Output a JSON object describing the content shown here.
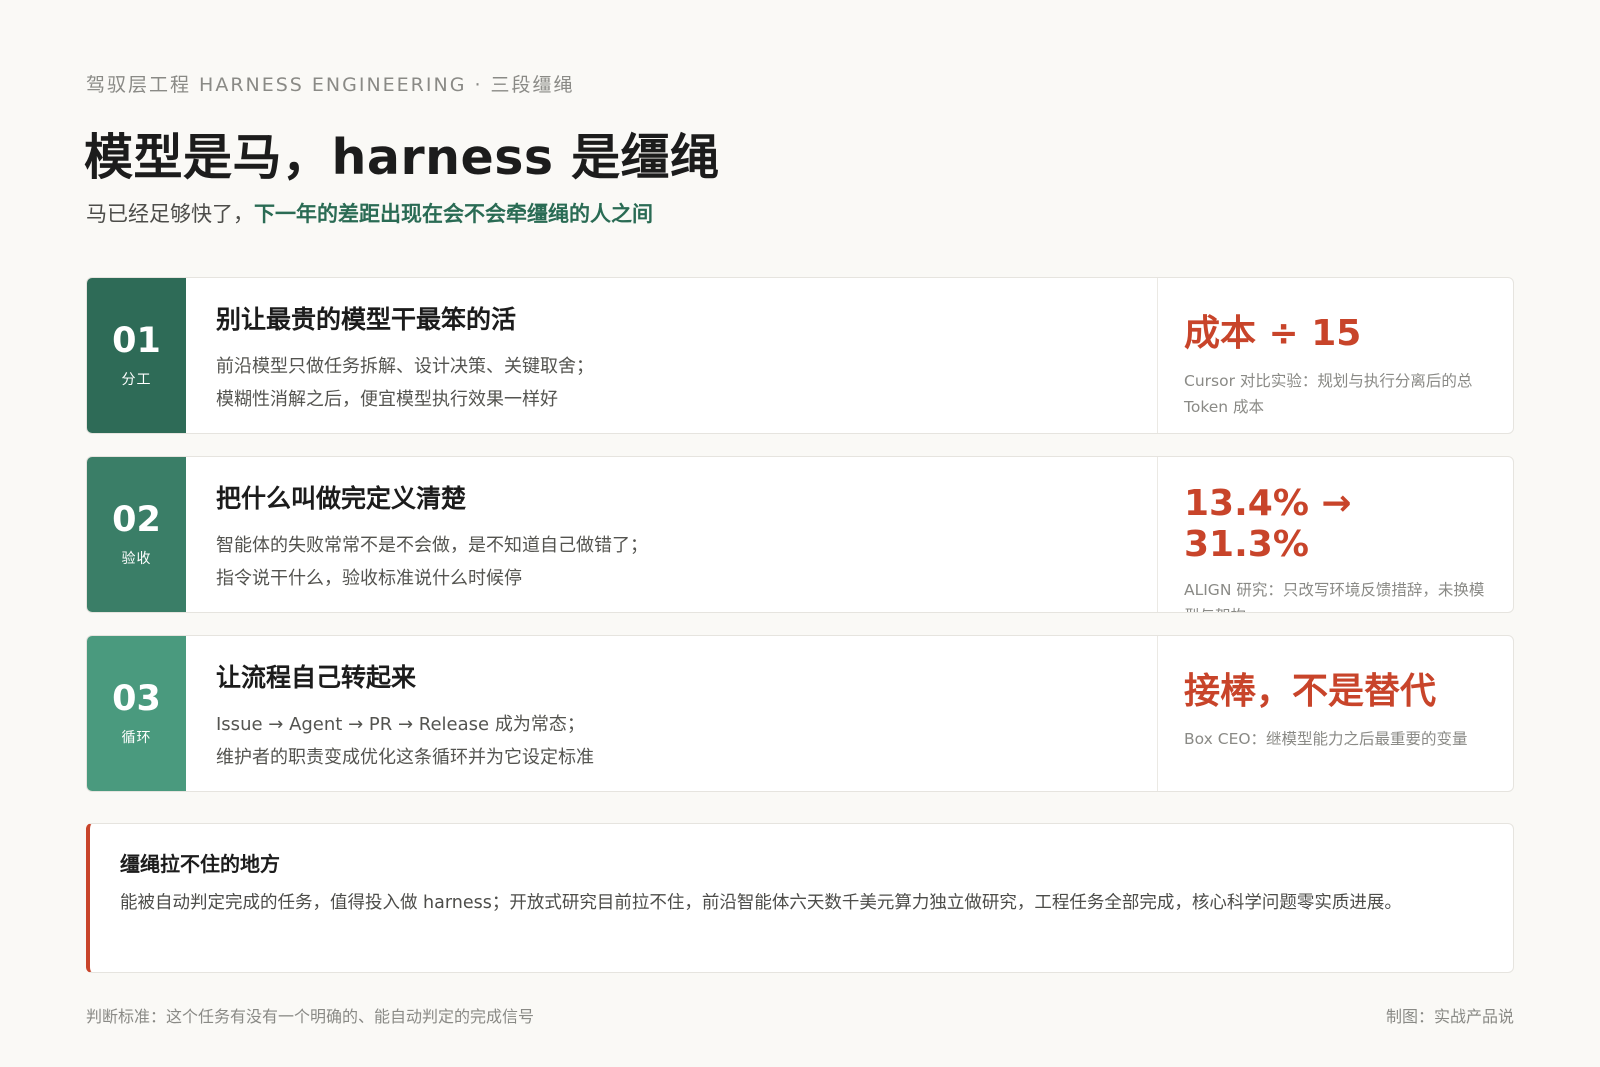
{
  "header": {
    "eyebrow": "驾驭层工程 HARNESS ENGINEERING · 三段缰绳",
    "title": "模型是马，harness 是缰绳",
    "subtitle_plain": "马已经足够快了，",
    "subtitle_highlight": "下一年的差距出现在会不会牵缰绳的人之间"
  },
  "cards": [
    {
      "number": "01",
      "tag": "分工",
      "heading": "别让最贵的模型干最笨的活",
      "lines": [
        "前沿模型只做任务拆解、设计决策、关键取舍；",
        "模糊性消解之后，便宜模型执行效果一样好"
      ],
      "stat": "成本 ÷ 15",
      "note": "Cursor 对比实验：规划与执行分离后的总 Token 成本"
    },
    {
      "number": "02",
      "tag": "验收",
      "heading": "把什么叫做完定义清楚",
      "lines": [
        "智能体的失败常常不是不会做，是不知道自己做错了；",
        "指令说干什么，验收标准说什么时候停"
      ],
      "stat": "13.4% → 31.3%",
      "note": "ALIGN 研究：只改写环境反馈措辞，未换模型与架构"
    },
    {
      "number": "03",
      "tag": "循环",
      "heading": "让流程自己转起来",
      "lines": [
        "Issue → Agent → PR → Release 成为常态；",
        "维护者的职责变成优化这条循环并为它设定标准"
      ],
      "stat": "接棒，不是替代",
      "note": "Box CEO：继模型能力之后最重要的变量"
    }
  ],
  "limit": {
    "heading": "缰绳拉不住的地方",
    "text": "能被自动判定完成的任务，值得投入做 harness；开放式研究目前拉不住，前沿智能体六天数千美元算力独立做研究，工程任务全部完成，核心科学问题零实质进展。"
  },
  "footer": {
    "criterion": "判断标准：这个任务有没有一个明确的、能自动判定的完成信号",
    "credit": "制图：实战产品说"
  },
  "colors": {
    "green_1": "#2e6b57",
    "green_2": "#3a7e67",
    "green_3": "#4a9a7e",
    "accent_red": "#c8442a",
    "highlight_green": "#2a6b54"
  }
}
